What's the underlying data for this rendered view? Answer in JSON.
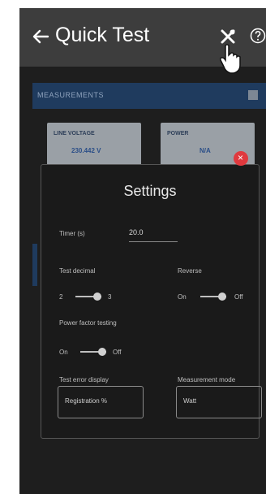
{
  "app": {
    "title": "Quick Test"
  },
  "measurements": {
    "label": "MEASUREMENTS",
    "tiles": [
      {
        "label": "LINE VOLTAGE",
        "value": "230.442 V"
      },
      {
        "label": "POWER",
        "value": "N/A"
      }
    ]
  },
  "settings": {
    "title": "Settings",
    "timer": {
      "label": "Timer (s)",
      "value": "20.0"
    },
    "test_decimal": {
      "label": "Test decimal",
      "left": "2",
      "right": "3"
    },
    "reverse": {
      "label": "Reverse",
      "left": "On",
      "right": "Off"
    },
    "power_factor": {
      "label": "Power factor testing",
      "left": "On",
      "right": "Off"
    },
    "test_error_display": {
      "label": "Test error display",
      "value": "Registration %"
    },
    "measurement_mode": {
      "label": "Measurement mode",
      "value": "Watt"
    }
  },
  "colors": {
    "appbar": "#3d3d3d",
    "background": "#1c1c1c",
    "accent": "#1f3b5e",
    "close": "#e0393e"
  },
  "icons": [
    "back-arrow-icon",
    "tools-icon",
    "help-icon",
    "pointer-hand-icon",
    "close-icon"
  ]
}
